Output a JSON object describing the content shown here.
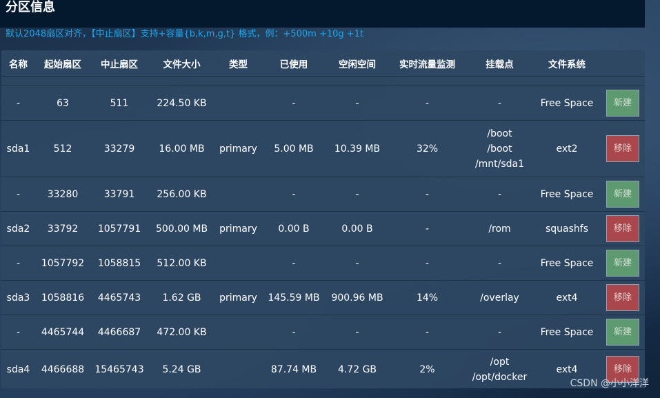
{
  "title": "分区信息",
  "hint": "默认2048扇区对齐，【中止扇区】支持+容量{b,k,m,g,t} 格式，例：+500m +10g +1t",
  "columns": [
    "名称",
    "起始扇区",
    "中止扇区",
    "文件大小",
    "类型",
    "已使用",
    "空闲空间",
    "实时流量监测",
    "挂载点",
    "文件系统",
    ""
  ],
  "rows": [
    {
      "name": "-",
      "start": "63",
      "end": "511",
      "size": "224.50 KB",
      "type": "",
      "used": "-",
      "free": "-",
      "traffic": "-",
      "mount": [
        "-"
      ],
      "fs": "Free Space",
      "action": "新建",
      "action_type": "new"
    },
    {
      "name": "sda1",
      "start": "512",
      "end": "33279",
      "size": "16.00 MB",
      "type": "primary",
      "used": "5.00 MB",
      "free": "10.39 MB",
      "traffic": "32%",
      "mount": [
        "/boot",
        "/boot",
        "/mnt/sda1"
      ],
      "fs": "ext2",
      "action": "移除",
      "action_type": "remove"
    },
    {
      "name": "-",
      "start": "33280",
      "end": "33791",
      "size": "256.00 KB",
      "type": "",
      "used": "-",
      "free": "-",
      "traffic": "-",
      "mount": [
        "-"
      ],
      "fs": "Free Space",
      "action": "新建",
      "action_type": "new"
    },
    {
      "name": "sda2",
      "start": "33792",
      "end": "1057791",
      "size": "500.00 MB",
      "type": "primary",
      "used": "0.00 B",
      "free": "0.00 B",
      "traffic": "-",
      "mount": [
        "/rom"
      ],
      "fs": "squashfs",
      "action": "移除",
      "action_type": "remove"
    },
    {
      "name": "-",
      "start": "1057792",
      "end": "1058815",
      "size": "512.00 KB",
      "type": "",
      "used": "-",
      "free": "-",
      "traffic": "-",
      "mount": [
        "-"
      ],
      "fs": "Free Space",
      "action": "新建",
      "action_type": "new"
    },
    {
      "name": "sda3",
      "start": "1058816",
      "end": "4465743",
      "size": "1.62 GB",
      "type": "primary",
      "used": "145.59 MB",
      "free": "900.96 MB",
      "traffic": "14%",
      "mount": [
        "/overlay"
      ],
      "fs": "ext4",
      "action": "移除",
      "action_type": "remove"
    },
    {
      "name": "-",
      "start": "4465744",
      "end": "4466687",
      "size": "472.00 KB",
      "type": "",
      "used": "-",
      "free": "-",
      "traffic": "-",
      "mount": [
        "-"
      ],
      "fs": "Free Space",
      "action": "新建",
      "action_type": "new"
    },
    {
      "name": "sda4",
      "start": "4466688",
      "end": "15465743",
      "size": "5.24 GB",
      "type": "",
      "used": "87.74 MB",
      "free": "4.72 GB",
      "traffic": "2%",
      "mount": [
        "/opt",
        "/opt/docker"
      ],
      "fs": "ext4",
      "action": "移除",
      "action_type": "remove"
    }
  ],
  "watermark": "CSDN @小小洋洋"
}
